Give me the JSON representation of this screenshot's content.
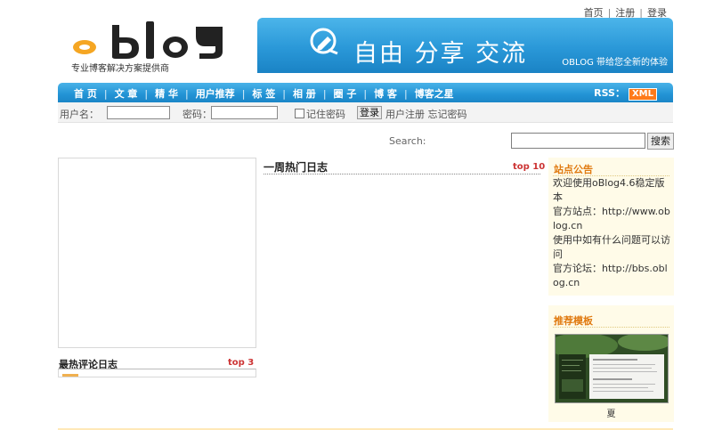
{
  "top_links": [
    "首页",
    "注册",
    "登录"
  ],
  "logo": {
    "text": "oblog",
    "subtitle": "专业博客解决方案提供商"
  },
  "banner": {
    "slogan": "自由 分享 交流",
    "tagline": "OBLOG 带给您全新的体验"
  },
  "nav": {
    "items": [
      "首 页",
      "文 章",
      "精 华",
      "用户推荐",
      "标 签",
      "相 册",
      "圈 子",
      "博 客",
      "博客之星"
    ],
    "rss_label": "RSS：",
    "xml_badge": "XML"
  },
  "login": {
    "username_label": "用户名：",
    "password_label": "密码：",
    "remember_label": "记住密码",
    "login_button": "登录",
    "register_link": "用户注册",
    "forgot_link": "忘记密码"
  },
  "search": {
    "label": "Search:",
    "button": "搜索",
    "value": ""
  },
  "hot_comment": {
    "title": "最热评论日志",
    "badge": "top 3"
  },
  "weekly_hot": {
    "title": "一周热门日志",
    "badge": "top 10"
  },
  "notice": {
    "title": "站点公告",
    "lines": [
      "欢迎使用oBlog4.6稳定版本",
      "官方站点：http://www.oblog.cn",
      "使用中如有什么问题可以访问",
      "官方论坛：http://bbs.oblog.cn"
    ]
  },
  "template": {
    "title": "推荐模板",
    "name": "夏"
  },
  "colors": {
    "nav_blue": "#2293d5",
    "accent_orange": "#e07a10",
    "badge_red": "#cc3333",
    "notice_bg": "#fffbe8"
  }
}
